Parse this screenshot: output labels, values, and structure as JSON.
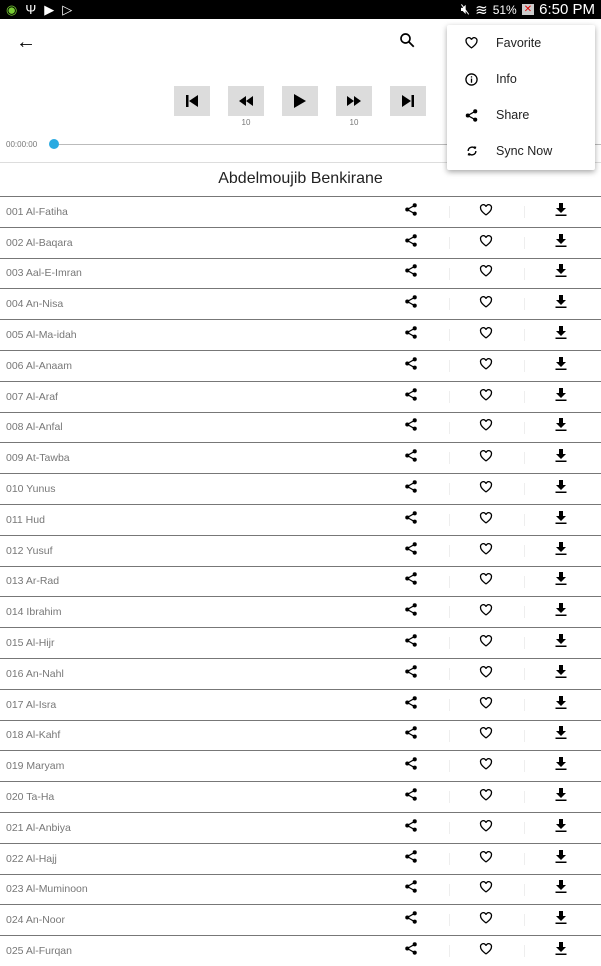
{
  "status_bar": {
    "battery": "51%",
    "time": "6:50 PM"
  },
  "player": {
    "rewind_seconds": "10",
    "forward_seconds": "10",
    "elapsed": "00:00:00",
    "progress": 0
  },
  "reciter": "Abdelmoujib Benkirane",
  "menu": [
    {
      "label": "Favorite",
      "icon": "heart-icon"
    },
    {
      "label": "Info",
      "icon": "info-icon"
    },
    {
      "label": "Share",
      "icon": "share-icon"
    },
    {
      "label": "Sync Now",
      "icon": "sync-icon"
    }
  ],
  "surahs": [
    "001 Al-Fatiha",
    "002 Al-Baqara",
    "003 Aal-E-Imran",
    "004 An-Nisa",
    "005 Al-Ma-idah",
    "006 Al-Anaam",
    "007 Al-Araf",
    "008 Al-Anfal",
    "009 At-Tawba",
    "010 Yunus",
    "011 Hud",
    "012 Yusuf",
    "013 Ar-Rad",
    "014 Ibrahim",
    "015 Al-Hijr",
    "016 An-Nahl",
    "017 Al-Isra",
    "018 Al-Kahf",
    "019 Maryam",
    "020 Ta-Ha",
    "021 Al-Anbiya",
    "022 Al-Hajj",
    "023 Al-Muminoon",
    "024 An-Noor",
    "025 Al-Furqan"
  ],
  "colors": {
    "accent": "#29aae1"
  }
}
